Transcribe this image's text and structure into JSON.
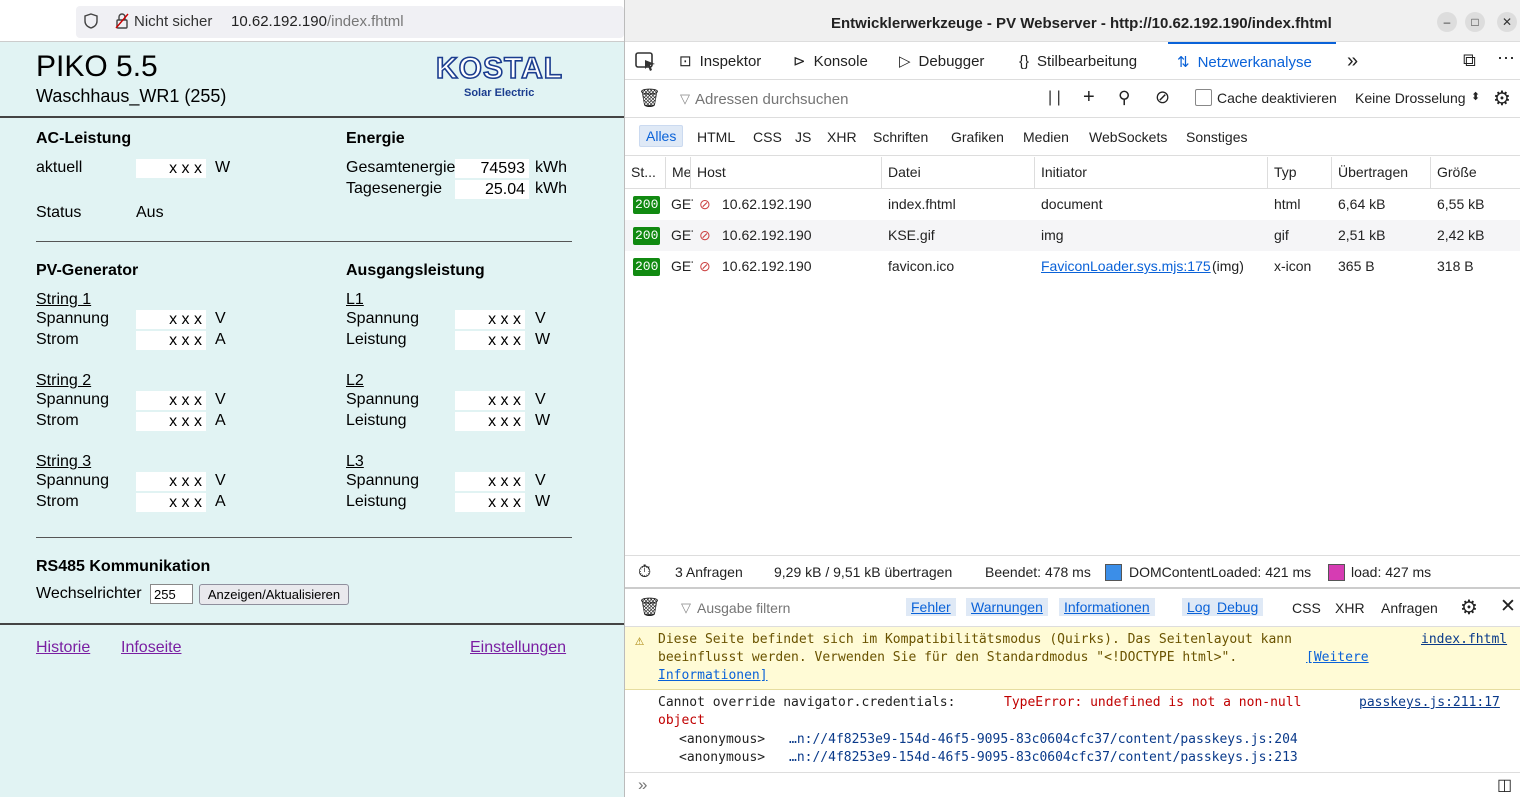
{
  "browser": {
    "not_secure": "Nicht sicher",
    "url_host": "10.62.192.190",
    "url_path": "/index.fhtml"
  },
  "page": {
    "title": "PIKO 5.5",
    "subtitle": "Waschhaus_WR1 (255)",
    "logo_text": "KOSTAL",
    "logo_sub": "Solar Electric",
    "ac": {
      "heading": "AC-Leistung",
      "aktuell_label": "aktuell",
      "aktuell_value": "x x x",
      "aktuell_unit": "W",
      "status_label": "Status",
      "status_value": "Aus"
    },
    "energie": {
      "heading": "Energie",
      "gesamt_label": "Gesamtenergie",
      "gesamt_value": "74593",
      "gesamt_unit": "kWh",
      "tages_label": "Tagesenergie",
      "tages_value": "25.04",
      "tages_unit": "kWh"
    },
    "pv": {
      "heading": "PV-Generator",
      "strings": [
        {
          "name": "String 1",
          "spannung_label": "Spannung",
          "spannung": "x x x",
          "spannung_unit": "V",
          "strom_label": "Strom",
          "strom": "x x x",
          "strom_unit": "A"
        },
        {
          "name": "String 2",
          "spannung_label": "Spannung",
          "spannung": "x x x",
          "spannung_unit": "V",
          "strom_label": "Strom",
          "strom": "x x x",
          "strom_unit": "A"
        },
        {
          "name": "String 3",
          "spannung_label": "Spannung",
          "spannung": "x x x",
          "spannung_unit": "V",
          "strom_label": "Strom",
          "strom": "x x x",
          "strom_unit": "A"
        }
      ]
    },
    "out": {
      "heading": "Ausgangsleistung",
      "phases": [
        {
          "name": "L1",
          "spannung_label": "Spannung",
          "spannung": "x x x",
          "spannung_unit": "V",
          "leistung_label": "Leistung",
          "leistung": "x x x",
          "leistung_unit": "W"
        },
        {
          "name": "L2",
          "spannung_label": "Spannung",
          "spannung": "x x x",
          "spannung_unit": "V",
          "leistung_label": "Leistung",
          "leistung": "x x x",
          "leistung_unit": "W"
        },
        {
          "name": "L3",
          "spannung_label": "Spannung",
          "spannung": "x x x",
          "spannung_unit": "V",
          "leistung_label": "Leistung",
          "leistung": "x x x",
          "leistung_unit": "W"
        }
      ]
    },
    "rs485": {
      "heading": "RS485 Kommunikation",
      "label": "Wechselrichter",
      "value": "255",
      "button": "Anzeigen/Aktualisieren"
    },
    "links": {
      "historie": "Historie",
      "infoseite": "Infoseite",
      "einstellungen": "Einstellungen"
    }
  },
  "devtools": {
    "title": "Entwicklerwerkzeuge - PV Webserver - http://10.62.192.190/index.fhtml",
    "tabs": [
      "Inspektor",
      "Konsole",
      "Debugger",
      "Stilbearbeitung",
      "Netzwerkanalyse"
    ],
    "url_filter_placeholder": "Adressen durchsuchen",
    "cache_label": "Cache deaktivieren",
    "throttle": "Keine Drosselung",
    "filters": [
      "Alles",
      "HTML",
      "CSS",
      "JS",
      "XHR",
      "Schriften",
      "Grafiken",
      "Medien",
      "WebSockets",
      "Sonstiges"
    ],
    "columns": [
      "St...",
      "Me",
      "Host",
      "Datei",
      "Initiator",
      "Typ",
      "Übertragen",
      "Größe"
    ],
    "requests": [
      {
        "status": "200",
        "method": "GET",
        "host": "10.62.192.190",
        "file": "index.fhtml",
        "initiator": "document",
        "initiator_extra": "",
        "type": "html",
        "transferred": "6,64 kB",
        "size": "6,55 kB"
      },
      {
        "status": "200",
        "method": "GET",
        "host": "10.62.192.190",
        "file": "KSE.gif",
        "initiator": "img",
        "initiator_extra": "",
        "type": "gif",
        "transferred": "2,51 kB",
        "size": "2,42 kB"
      },
      {
        "status": "200",
        "method": "GET",
        "host": "10.62.192.190",
        "file": "favicon.ico",
        "initiator": "FaviconLoader.sys.mjs:175",
        "initiator_extra": "(img)",
        "type": "x-icon",
        "transferred": "365 B",
        "size": "318 B"
      }
    ],
    "summary": {
      "requests": "3 Anfragen",
      "transferred": "9,29 kB / 9,51 kB übertragen",
      "finished": "Beendet: 478 ms",
      "domcontent": "DOMContentLoaded: 421 ms",
      "load": "load: 427 ms",
      "domcontent_color": "#3b8ee8",
      "load_color": "#d63cb3"
    },
    "console": {
      "filter_placeholder": "Ausgabe filtern",
      "levels": [
        "Fehler",
        "Warnungen",
        "Informationen",
        "Log",
        "Debug"
      ],
      "extra": [
        "CSS",
        "XHR",
        "Anfragen"
      ],
      "warning_line1": "Diese Seite befindet sich im Kompatibilitätsmodus (Quirks). Das Seitenlayout kann",
      "warning_line2": "beeinflusst werden. Verwenden Sie für den Standardmodus \"<!DOCTYPE html>\".",
      "warning_link1": "[Weitere",
      "warning_link2": "Informationen]",
      "warning_source": "index.fhtml",
      "error_prefix": "Cannot override navigator.credentials:",
      "error_msg": "TypeError: undefined is not a non-null",
      "error_msg2": "object",
      "error_source": "passkeys.js:211:17",
      "stack": [
        {
          "fn": "<anonymous>",
          "loc": "…n://4f8253e9-154d-46f5-9095-83c0604cfc37/content/passkeys.js:204"
        },
        {
          "fn": "<anonymous>",
          "loc": "…n://4f8253e9-154d-46f5-9095-83c0604cfc37/content/passkeys.js:213"
        }
      ],
      "prompt": "»"
    }
  }
}
